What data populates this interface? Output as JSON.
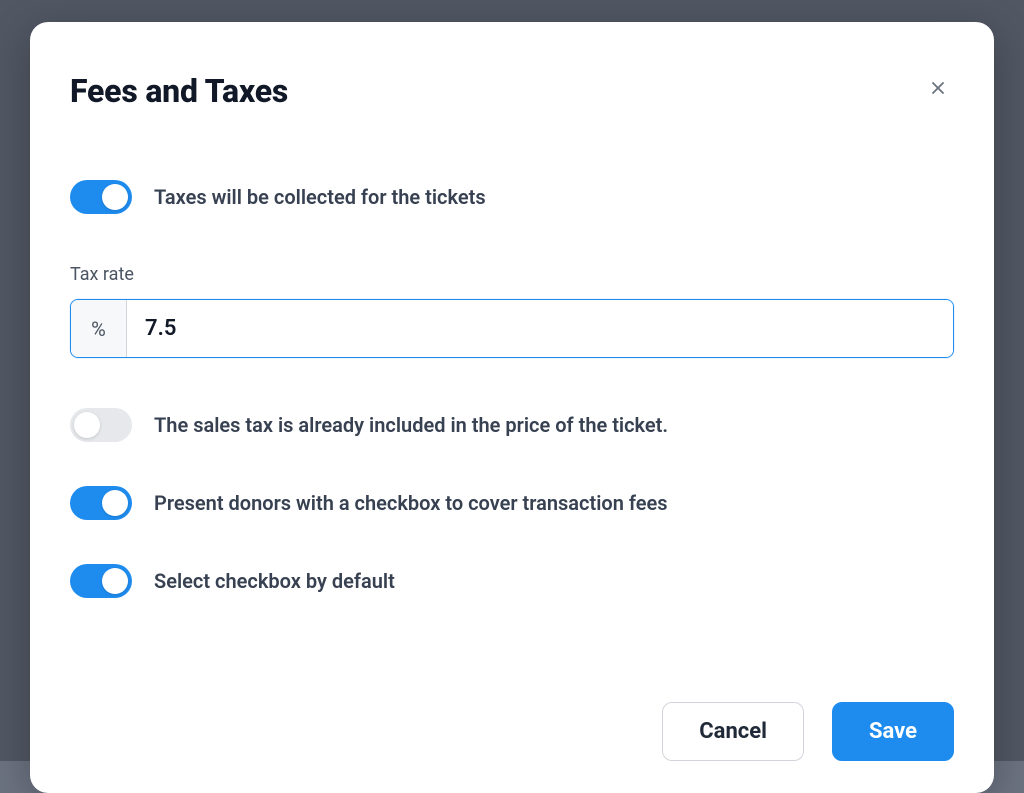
{
  "modal": {
    "title": "Fees and Taxes",
    "toggles": {
      "collect_taxes": {
        "label": "Taxes will be collected for the tickets",
        "on": true
      },
      "tax_included": {
        "label": "The sales tax is already included in the price of the ticket.",
        "on": false
      },
      "present_cover_fees": {
        "label": "Present donors with a checkbox to cover transaction fees",
        "on": true
      },
      "select_by_default": {
        "label": "Select checkbox by default",
        "on": true
      }
    },
    "tax_rate": {
      "label": "Tax rate",
      "prefix": "%",
      "value": "7.5"
    },
    "buttons": {
      "cancel": "Cancel",
      "save": "Save"
    }
  }
}
